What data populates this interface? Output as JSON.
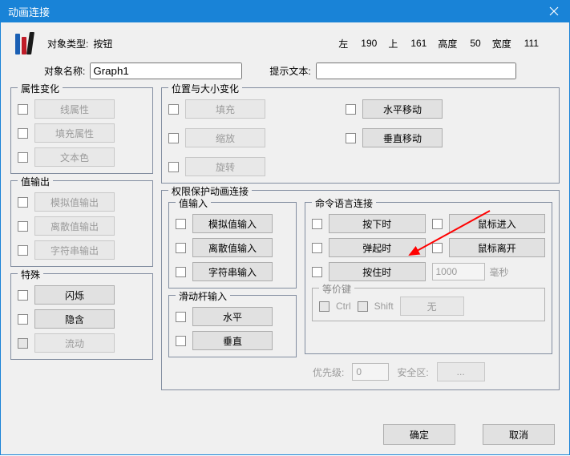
{
  "title": "动画连接",
  "header": {
    "objtype_label": "对象类型:",
    "objtype_value": "按钮",
    "left_label": "左",
    "left_value": "190",
    "top_label": "上",
    "top_value": "161",
    "height_label": "高度",
    "height_value": "50",
    "width_label": "宽度",
    "width_value": "111",
    "objname_label": "对象名称:",
    "objname_value": "Graph1",
    "tiptext_label": "提示文本:",
    "tiptext_value": ""
  },
  "attr_change": {
    "legend": "属性变化",
    "line_attr": "线属性",
    "fill_attr": "填充属性",
    "text_color": "文本色"
  },
  "pos_size": {
    "legend": "位置与大小变化",
    "fill": "填充",
    "scale": "缩放",
    "rotate": "旋转",
    "hmove": "水平移动",
    "vmove": "垂直移动"
  },
  "value_out": {
    "legend": "值输出",
    "analog": "模拟值输出",
    "discrete": "离散值输出",
    "string": "字符串输出"
  },
  "perm": {
    "legend": "权限保护动画连接",
    "value_in": {
      "legend": "值输入",
      "analog": "模拟值输入",
      "discrete": "离散值输入",
      "string": "字符串输入"
    },
    "cmd": {
      "legend": "命令语言连接",
      "press": "按下时",
      "release": "弹起时",
      "hold": "按住时",
      "mousein": "鼠标进入",
      "mouseout": "鼠标离开",
      "interval_value": "1000",
      "interval_unit": "毫秒",
      "equiv": {
        "legend": "等价键",
        "ctrl": "Ctrl",
        "shift": "Shift",
        "none": "无"
      }
    },
    "slider": {
      "legend": "滑动杆输入",
      "horiz": "水平",
      "vert": "垂直"
    },
    "priority_label": "优先级:",
    "priority_value": "0",
    "secarea_label": "安全区:",
    "secarea_value": "..."
  },
  "special": {
    "legend": "特殊",
    "blink": "闪烁",
    "hide": "隐含",
    "flow": "流动"
  },
  "footer": {
    "ok": "确定",
    "cancel": "取消"
  }
}
